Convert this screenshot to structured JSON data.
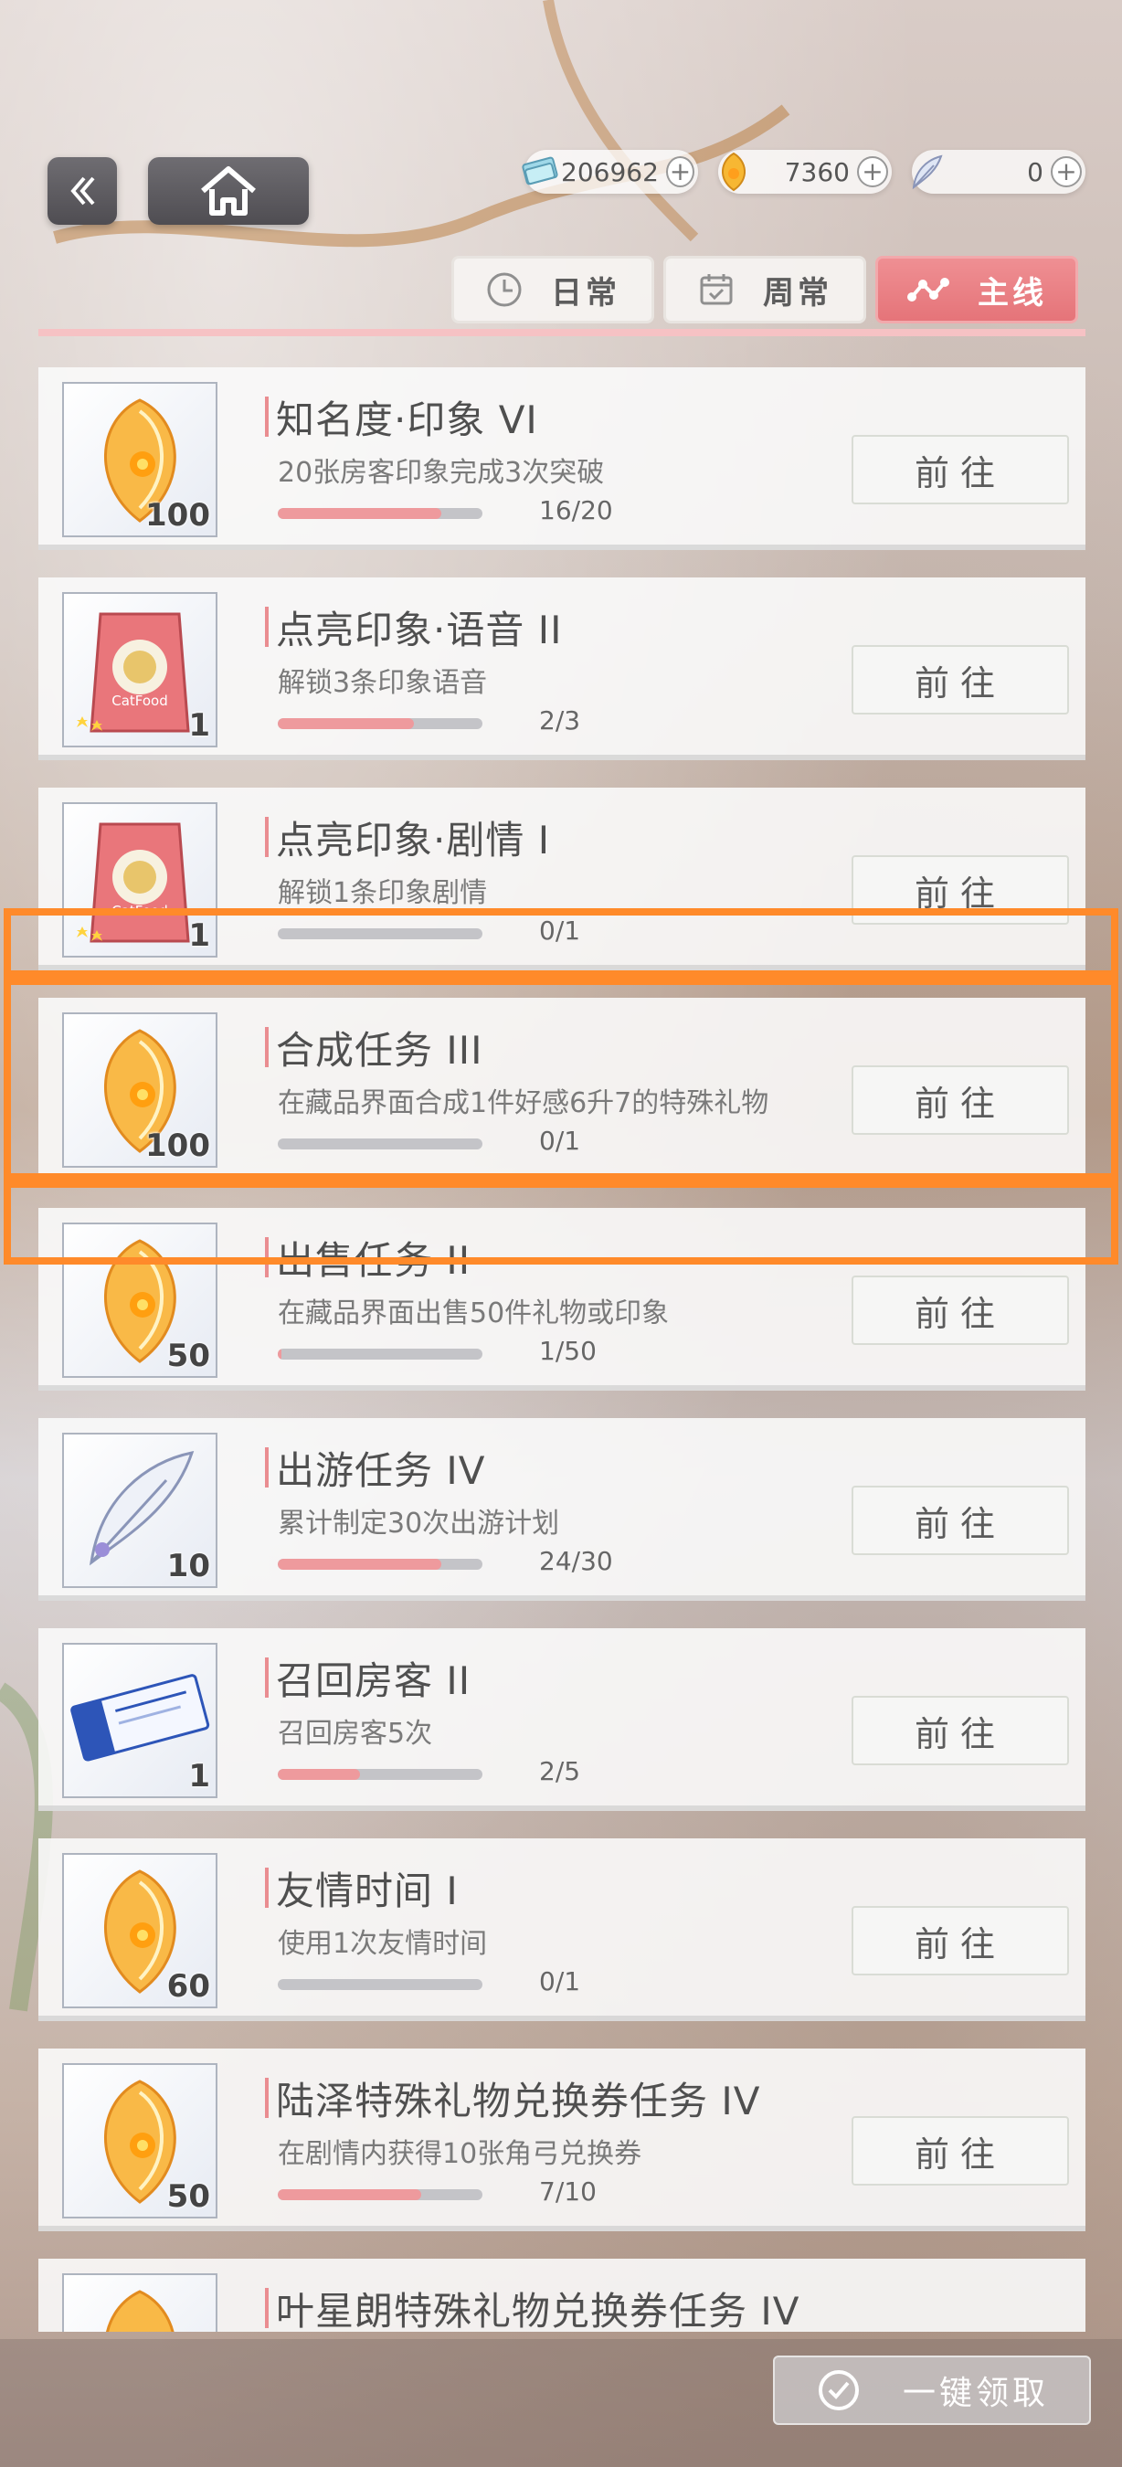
{
  "nav": {
    "back_icon": "double-chevron-left-icon",
    "home_icon": "home-icon"
  },
  "currencies": [
    {
      "icon": "cash-stack-icon",
      "value": "206962",
      "plus": "+"
    },
    {
      "icon": "gift-crystal-icon",
      "value": "7360",
      "plus": "+"
    },
    {
      "icon": "feather-icon",
      "value": "0",
      "plus": "+"
    }
  ],
  "tabs": [
    {
      "label": "日常",
      "icon": "clock-icon",
      "active": false
    },
    {
      "label": "周常",
      "icon": "calendar-icon",
      "active": false
    },
    {
      "label": "主线",
      "icon": "path-nodes-icon",
      "active": true
    }
  ],
  "tasks": [
    {
      "title": "知名度·印象 VI",
      "desc": "20张房客印象完成3次突破",
      "progress": "16/20",
      "fraction": 0.8,
      "reward": "crystal-icon",
      "qty": "100",
      "go": "前往"
    },
    {
      "title": "点亮印象·语音 II",
      "desc": "解锁3条印象语音",
      "progress": "2/3",
      "fraction": 0.667,
      "reward": "catfood-icon",
      "qty": "1",
      "go": "前往"
    },
    {
      "title": "点亮印象·剧情 I",
      "desc": "解锁1条印象剧情",
      "progress": "0/1",
      "fraction": 0,
      "reward": "catfood-icon",
      "qty": "1",
      "go": "前往"
    },
    {
      "title": "合成任务 III",
      "desc": "在藏品界面合成1件好感6升7的特殊礼物",
      "progress": "0/1",
      "fraction": 0,
      "reward": "crystal-icon",
      "qty": "100",
      "go": "前往"
    },
    {
      "title": "出售任务 II",
      "desc": "在藏品界面出售50件礼物或印象",
      "progress": "1/50",
      "fraction": 0.02,
      "reward": "crystal-icon",
      "qty": "50",
      "go": "前往"
    },
    {
      "title": "出游任务 IV",
      "desc": "累计制定30次出游计划",
      "progress": "24/30",
      "fraction": 0.8,
      "reward": "feather-icon",
      "qty": "10",
      "go": "前往"
    },
    {
      "title": "召回房客 II",
      "desc": "召回房客5次",
      "progress": "2/5",
      "fraction": 0.4,
      "reward": "ticket-icon",
      "qty": "1",
      "go": "前往"
    },
    {
      "title": "友情时间 I",
      "desc": "使用1次友情时间",
      "progress": "0/1",
      "fraction": 0,
      "reward": "crystal-icon",
      "qty": "60",
      "go": "前往"
    },
    {
      "title": "陆泽特殊礼物兑换券任务 IV",
      "desc": "在剧情内获得10张角弓兑换券",
      "progress": "7/10",
      "fraction": 0.7,
      "reward": "crystal-icon",
      "qty": "50",
      "go": "前往"
    },
    {
      "title": "叶星朗特殊礼物兑换券任务 IV",
      "desc": "",
      "progress": "",
      "fraction": 0,
      "reward": "crystal-icon",
      "qty": "",
      "go": ""
    }
  ],
  "claim_all": {
    "label": "一键领取",
    "icon": "check-circle-icon"
  },
  "colors": {
    "accent": "#e57479",
    "highlight": "#ff8a2a",
    "progress_fill": "#ee9a9d"
  }
}
